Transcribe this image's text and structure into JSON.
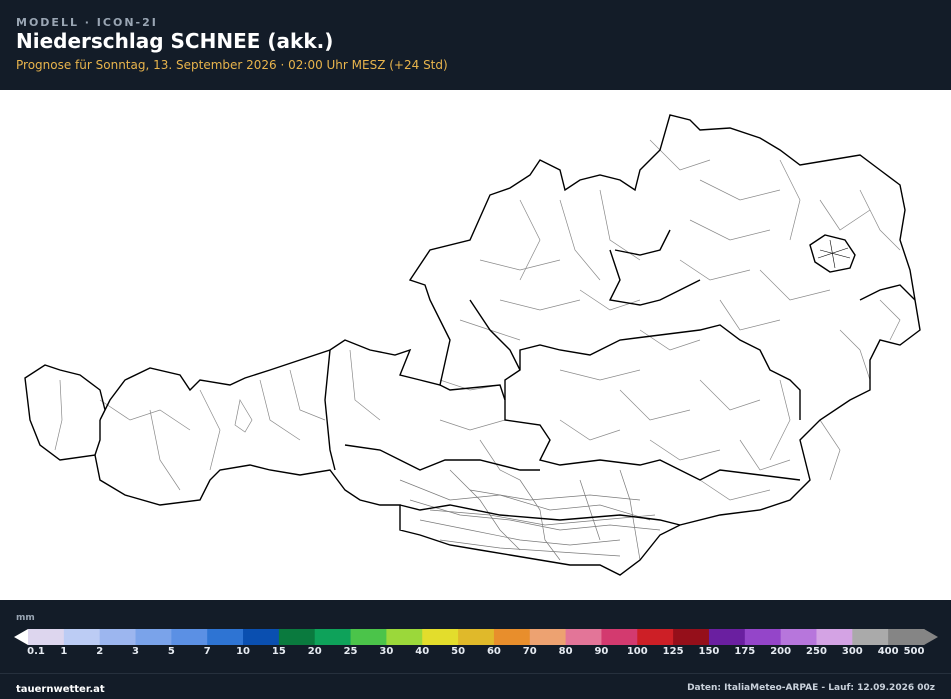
{
  "header": {
    "model_label": "MODELL · ICON-2I",
    "title": "Niederschlag SCHNEE (akk.)",
    "forecast": "Prognose für Sonntag, 13. September 2026 · 02:00 Uhr MESZ  (+24 Std)"
  },
  "legend": {
    "unit": "mm",
    "colors": [
      "#ddd6ee",
      "#bcccf4",
      "#9cb6ef",
      "#7aa3ea",
      "#5b90e4",
      "#2e74d3",
      "#0a4fb0",
      "#0a7a3e",
      "#0ea25a",
      "#4bc44a",
      "#9bd83a",
      "#e3dd2c",
      "#e0b92a",
      "#e88e2c",
      "#eda271",
      "#e37598",
      "#d33a6f",
      "#cd1f26",
      "#950f1a",
      "#6a1fa0",
      "#9445c9",
      "#b776dc",
      "#d4a3e4",
      "#aaaaaa",
      "#858585"
    ],
    "ticks": [
      "0.1",
      "1",
      "2",
      "3",
      "5",
      "7",
      "10",
      "15",
      "20",
      "25",
      "30",
      "40",
      "50",
      "60",
      "70",
      "80",
      "90",
      "100",
      "125",
      "150",
      "175",
      "200",
      "250",
      "300",
      "400",
      "500"
    ]
  },
  "footer": {
    "site": "tauernwetter.at",
    "credit": "Daten: ItaliaMeteo-ARPAE - Lauf: 12.09.2026 00z"
  }
}
